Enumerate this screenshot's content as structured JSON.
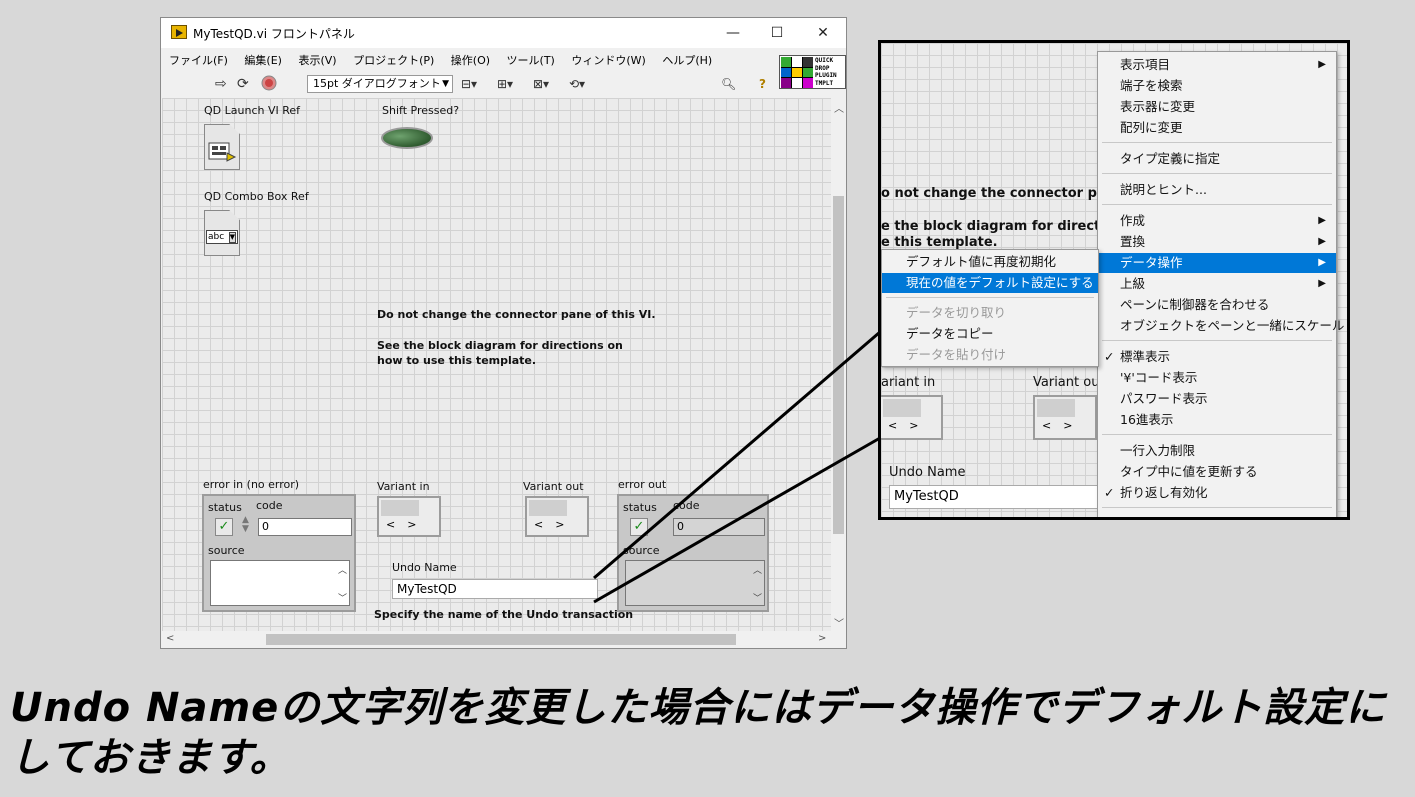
{
  "window": {
    "title": "MyTestQD.vi フロントパネル",
    "controls": {
      "minimize": "—",
      "maximize": "☐",
      "close": "✕"
    }
  },
  "menubar": [
    "ファイル(F)",
    "編集(E)",
    "表示(V)",
    "プロジェクト(P)",
    "操作(O)",
    "ツール(T)",
    "ウィンドウ(W)",
    "ヘルプ(H)"
  ],
  "toolbar": {
    "font": "15pt ダイアログフォント",
    "icons": [
      "run-arrow-icon",
      "run-continuous-icon",
      "abort-icon",
      "align-icon",
      "distribute-icon",
      "resize-icon",
      "reorder-icon",
      "search-icon",
      "help-icon"
    ],
    "quickdrop_text": [
      "QUICK",
      "DROP",
      "PLUGIN",
      "TMPLT"
    ]
  },
  "panel": {
    "qd_launch_label": "QD Launch VI Ref",
    "qd_combo_label": "QD Combo Box Ref",
    "combo_text": "abc",
    "shift_label": "Shift Pressed?",
    "note1": "Do not change the connector pane of this VI.",
    "note2": "See the block diagram for directions on how to use this template.",
    "error_in_label": "error in (no error)",
    "error_out_label": "error out",
    "status_label": "status",
    "code_label": "code",
    "source_label": "source",
    "code_value": "0",
    "variant_in_label": "Variant in",
    "variant_out_label": "Variant out",
    "undo_label": "Undo Name",
    "undo_value": "MyTestQD",
    "undo_desc": "Specify the name of the Undo transaction"
  },
  "zoom": {
    "bg_note1": "o not change the connector pane of",
    "bg_note2a": "e the block diagram for directions o",
    "bg_note2b": "e this template.",
    "variant_in_label": "ariant in",
    "variant_out_label": "Variant out",
    "undo_label": "Undo Name",
    "undo_value": "MyTestQD",
    "context_menu": [
      {
        "label": "表示項目",
        "sub": true
      },
      {
        "label": "端子を検索"
      },
      {
        "label": "表示器に変更"
      },
      {
        "label": "配列に変更"
      },
      {
        "sep": true
      },
      {
        "label": "タイプ定義に指定"
      },
      {
        "sep": true
      },
      {
        "label": "説明とヒント..."
      },
      {
        "sep": true
      },
      {
        "label": "作成",
        "sub": true
      },
      {
        "label": "置換",
        "sub": true
      },
      {
        "label": "データ操作",
        "sub": true,
        "highlight": true
      },
      {
        "label": "上級",
        "sub": true
      },
      {
        "label": "ペーンに制御器を合わせる"
      },
      {
        "label": "オブジェクトをペーンと一緒にスケール"
      },
      {
        "sep": true
      },
      {
        "label": "標準表示",
        "check": true
      },
      {
        "label": "'¥'コード表示"
      },
      {
        "label": "パスワード表示"
      },
      {
        "label": "16進表示"
      },
      {
        "sep": true
      },
      {
        "label": "一行入力制限"
      },
      {
        "label": "タイプ中に値を更新する"
      },
      {
        "label": "折り返し有効化",
        "check": true
      }
    ],
    "submenu": [
      {
        "label": "デフォルト値に再度初期化"
      },
      {
        "label": "現在の値をデフォルト設定にする",
        "highlight": true
      },
      {
        "sep": true
      },
      {
        "label": "データを切り取り",
        "disabled": true
      },
      {
        "label": "データをコピー"
      },
      {
        "label": "データを貼り付け",
        "disabled": true
      }
    ]
  },
  "caption": "Undo Nameの文字列を変更した場合にはデータ操作でデフォルト設定にしておきます。",
  "colors": {
    "highlight": "#0078d7",
    "background": "#d8d8d8",
    "led": "#2f5b2f"
  }
}
